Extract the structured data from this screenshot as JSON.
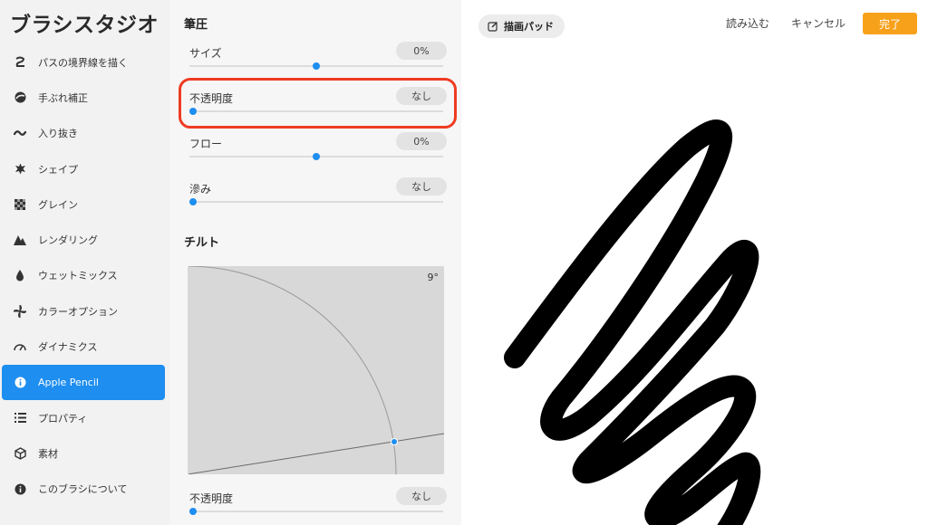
{
  "app": {
    "title": "ブラシスタジオ"
  },
  "sidebar": {
    "items": [
      {
        "label": "パスの境界線を描く",
        "icon": "stroke-path-icon",
        "active": false
      },
      {
        "label": "手ぶれ補正",
        "icon": "stabilization-icon",
        "active": false
      },
      {
        "label": "入り抜き",
        "icon": "taper-icon",
        "active": false
      },
      {
        "label": "シェイプ",
        "icon": "shape-icon",
        "active": false
      },
      {
        "label": "グレイン",
        "icon": "grain-icon",
        "active": false
      },
      {
        "label": "レンダリング",
        "icon": "rendering-icon",
        "active": false
      },
      {
        "label": "ウェットミックス",
        "icon": "wet-mix-icon",
        "active": false
      },
      {
        "label": "カラーオプション",
        "icon": "color-options-icon",
        "active": false
      },
      {
        "label": "ダイナミクス",
        "icon": "dynamics-icon",
        "active": false
      },
      {
        "label": "Apple Pencil",
        "icon": "apple-pencil-icon",
        "active": true
      },
      {
        "label": "プロパティ",
        "icon": "properties-icon",
        "active": false
      },
      {
        "label": "素材",
        "icon": "materials-icon",
        "active": false
      },
      {
        "label": "このブラシについて",
        "icon": "about-brush-icon",
        "active": false
      }
    ]
  },
  "pressure": {
    "title": "筆圧",
    "size": {
      "label": "サイズ",
      "value": "0%",
      "level": 0.5
    },
    "opacity": {
      "label": "不透明度",
      "value": "なし",
      "level": 0.0
    },
    "flow": {
      "label": "フロー",
      "value": "0%",
      "level": 0.5
    },
    "bleed": {
      "label": "滲み",
      "value": "なし",
      "level": 0.0
    }
  },
  "tilt": {
    "title": "チルト",
    "angle": "9°",
    "opacity": {
      "label": "不透明度",
      "value": "なし",
      "level": 0.0
    }
  },
  "topbar": {
    "drawing_pad": "描画パッド",
    "import": "読み込む",
    "cancel": "キャンセル",
    "done": "完了"
  },
  "colors": {
    "accent": "#1e8ef0",
    "highlight": "#ee3b22",
    "done": "#f7a11a"
  }
}
